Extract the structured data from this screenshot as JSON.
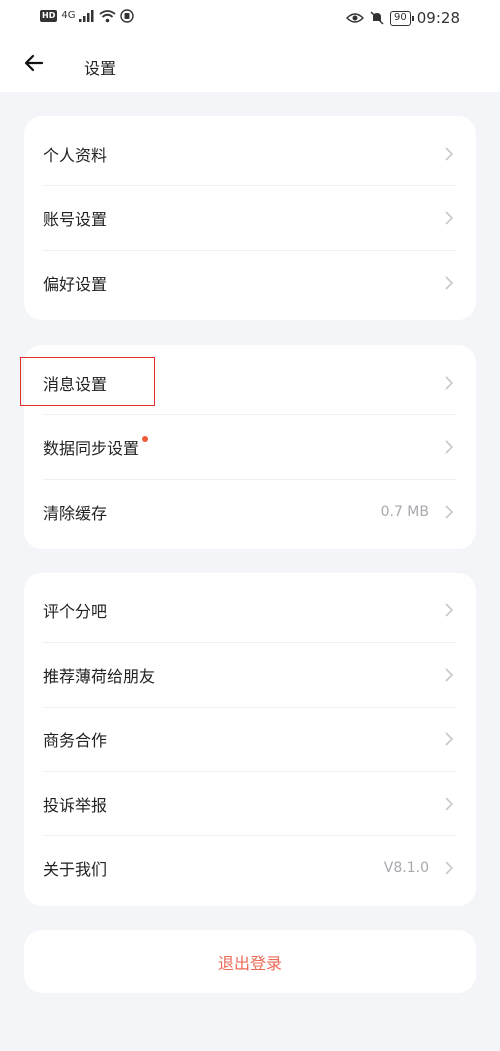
{
  "status_bar": {
    "hd_badge": "HD",
    "network": "4G",
    "battery": "90",
    "time": "09:28",
    "icons": [
      "signal-icon",
      "wifi-icon",
      "notification-icon",
      "eye-icon",
      "mute-icon",
      "battery-icon"
    ]
  },
  "header": {
    "title": "设置",
    "back_icon": "back-arrow-icon"
  },
  "groups": [
    {
      "items": [
        {
          "label": "个人资料"
        },
        {
          "label": "账号设置"
        },
        {
          "label": "偏好设置"
        }
      ]
    },
    {
      "items": [
        {
          "label": "消息设置"
        },
        {
          "label": "数据同步设置",
          "has_dot": true
        },
        {
          "label": "清除缓存",
          "value": "0.7 MB"
        }
      ]
    },
    {
      "items": [
        {
          "label": "评个分吧"
        },
        {
          "label": "推荐薄荷给朋友"
        },
        {
          "label": "商务合作"
        },
        {
          "label": "投诉举报"
        },
        {
          "label": "关于我们",
          "value": "V8.1.0"
        }
      ]
    }
  ],
  "logout": {
    "label": "退出登录"
  },
  "colors": {
    "background": "#f4f5f9",
    "card": "#ffffff",
    "logout": "#ec6a56",
    "dot": "#ee5a3c",
    "highlight": "#e0312f"
  }
}
